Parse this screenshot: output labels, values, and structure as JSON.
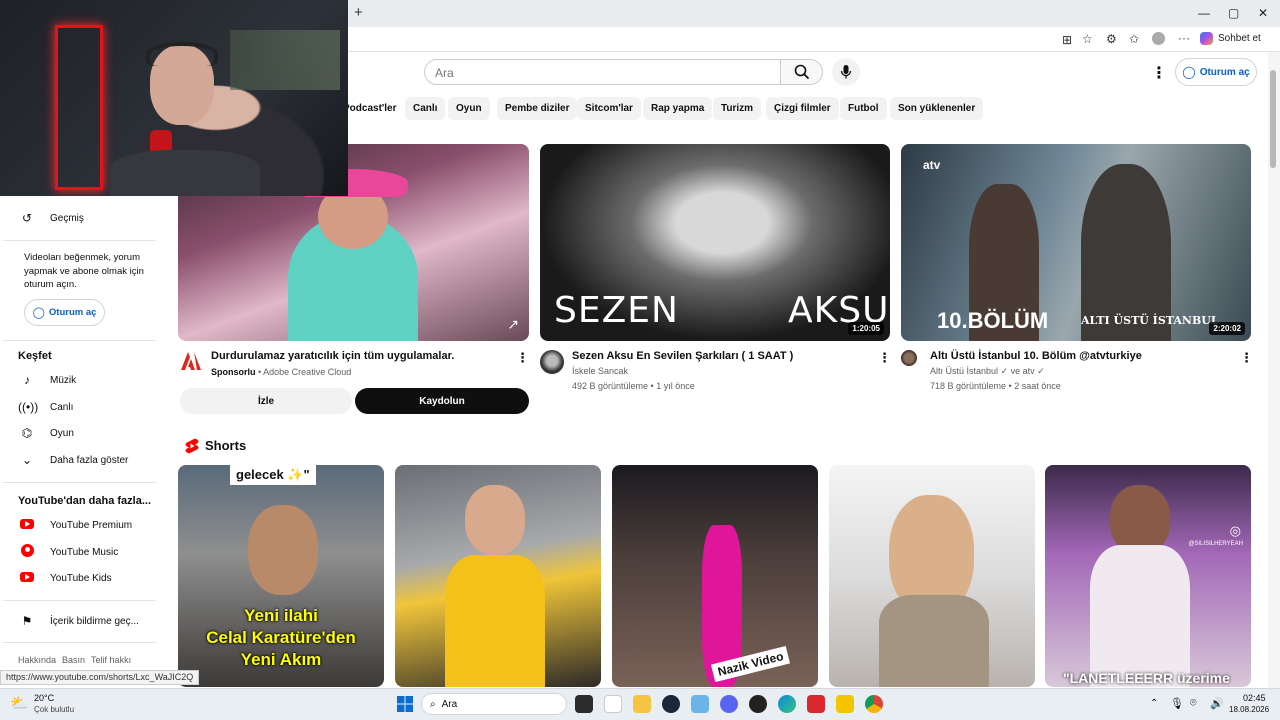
{
  "browser": {
    "new_tab": "+",
    "copilot_label": "Sohbet et",
    "minimize": "—",
    "maximize": "▢",
    "close": "✕"
  },
  "header": {
    "search_placeholder": "Ara",
    "signin_label": "Oturum aç"
  },
  "chips": [
    "Podcast'ler",
    "Canlı",
    "Oyun",
    "Pembe diziler",
    "Sitcom'lar",
    "Rap yapma",
    "Turizm",
    "Çizgi filmler",
    "Futbol",
    "Son yüklenenler"
  ],
  "sidebar": {
    "history": "Geçmiş",
    "signin_prompt": "Videoları beğenmek, yorum yapmak ve abone olmak için oturum açın.",
    "signin_button": "Oturum aç",
    "explore_title": "Keşfet",
    "explore_items": [
      "Müzik",
      "Canlı",
      "Oyun",
      "Daha fazla göster"
    ],
    "more_title": "YouTube'dan daha fazla...",
    "more_items": [
      "YouTube Premium",
      "YouTube Music",
      "YouTube Kids"
    ],
    "report": "İçerik bildirme geç...",
    "footer_links": [
      "Hakkında",
      "Basın",
      "Telif hakkı"
    ]
  },
  "ad": {
    "title": "Durdurulamaz yaratıcılık için tüm uygulamalar.",
    "sponsor": "Sponsorlu",
    "advertiser": "Adobe Creative Cloud",
    "watch_button": "İzle",
    "subscribe_button": "Kaydolun"
  },
  "videos": [
    {
      "title": "Sezen Aksu En Sevilen Şarkıları ( 1 SAAT )",
      "channel": "İskele Sancak",
      "meta": "492 B görüntüleme • 1 yıl önce",
      "duration": "1:20:05",
      "overlay_left": "SEZEN",
      "overlay_right": "AKSU"
    },
    {
      "title": "Altı Üstü İstanbul 10. Bölüm @atvturkiye",
      "channel": "Altı Üstü İstanbul ✓ ve atv ✓",
      "meta": "718 B görüntüleme • 2 saat önce",
      "duration": "2:20:02",
      "overlay": "10.BÖLÜM",
      "overlay_brand": "ALTI ÜSTÜ İSTANBUL",
      "logo": "atv"
    }
  ],
  "shorts": {
    "title": "Shorts",
    "items": [
      {
        "top_caption": "gelecek ✨\"",
        "caption": "Yeni ilahi\nCelal Karatüre'den\nYeni Akım"
      },
      {
        "caption": ""
      },
      {
        "caption": "Nazik Video"
      },
      {
        "caption": ""
      },
      {
        "caption": "\"LANETLEEERR üzerime",
        "watermark": "@SILISILHERYEAH"
      }
    ]
  },
  "status_url": "https://www.youtube.com/shorts/Lxc_WaJIC2Q",
  "taskbar": {
    "weather_temp": "20°C",
    "weather_desc": "Çok bulutlu",
    "search": "Ara",
    "time": "02:45",
    "date": "18.08.2026"
  }
}
